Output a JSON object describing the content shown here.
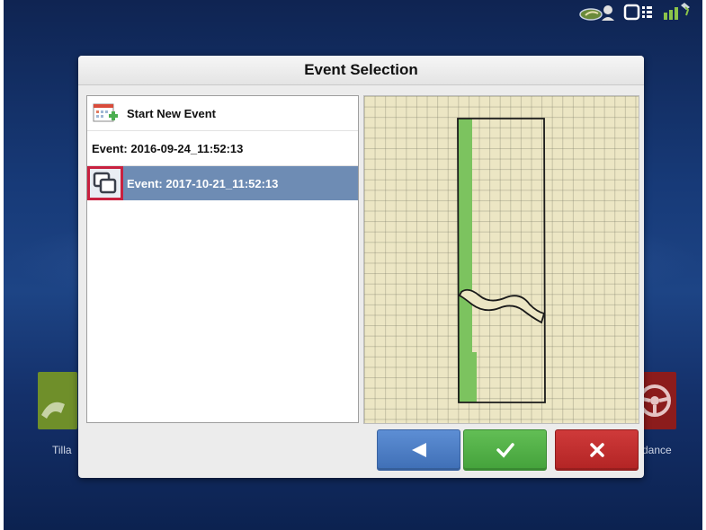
{
  "dialog": {
    "title": "Event Selection",
    "list_items": [
      {
        "label": "Start New Event",
        "icon": "calendar-add-icon"
      },
      {
        "label": "Event: 2016-09-24_11:52:13"
      },
      {
        "label": "Event: 2017-10-21_11:52:13",
        "icon": "copy-icon",
        "selected": true
      }
    ],
    "buttons": {
      "back_icon": "arrow-left-icon",
      "ok_icon": "checkmark-icon",
      "cancel_icon": "close-icon"
    }
  },
  "background": {
    "left_tile_label": "Tilla",
    "right_tile_label": "dance"
  },
  "colors": {
    "selection": "#6e8cb4",
    "highlight_border": "#c8213f",
    "back_button": "#4a7cc4",
    "ok_button": "#4fae44",
    "cancel_button": "#c22f2f",
    "coverage_green": "#7cc35f"
  }
}
